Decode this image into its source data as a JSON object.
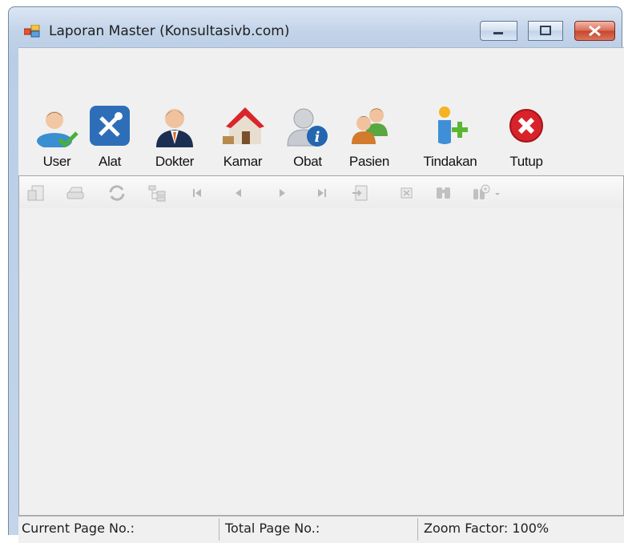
{
  "window": {
    "title": "Laporan Master (Konsultasivb.com)"
  },
  "toolbar": {
    "items": [
      {
        "label": "User",
        "icon": "user-check-icon"
      },
      {
        "label": "Alat",
        "icon": "tools-icon"
      },
      {
        "label": "Dokter",
        "icon": "doctor-icon"
      },
      {
        "label": "Kamar",
        "icon": "house-icon"
      },
      {
        "label": "Obat",
        "icon": "user-info-icon"
      },
      {
        "label": "Pasien",
        "icon": "patients-icon"
      },
      {
        "label": "Tindakan",
        "icon": "add-person-icon"
      },
      {
        "label": "Tutup",
        "icon": "close-circle-icon"
      }
    ]
  },
  "viewer_toolbar": {
    "buttons": [
      "export-icon",
      "print-icon",
      "refresh-icon",
      "group-tree-icon",
      "first-page-icon",
      "previous-page-icon",
      "next-page-icon",
      "last-page-icon",
      "goto-page-icon",
      "stop-icon",
      "find-icon",
      "zoom-icon"
    ]
  },
  "status": {
    "current_page": "Current Page No.:",
    "total_page": "Total Page No.:",
    "zoom": "Zoom Factor: 100%"
  },
  "colors": {
    "accent": "#3b78c2",
    "close": "#d32f2f"
  }
}
